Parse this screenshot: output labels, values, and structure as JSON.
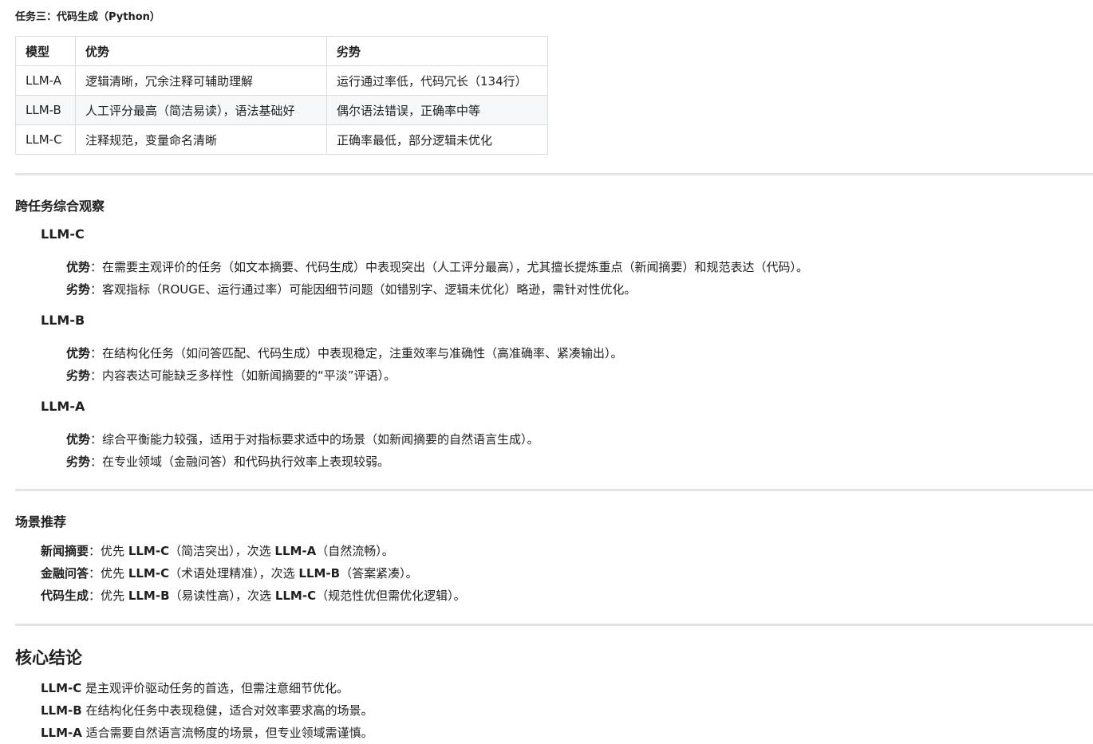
{
  "task3": {
    "title": "任务三：代码生成（Python）",
    "headers": [
      "模型",
      "优势",
      "劣势"
    ],
    "rows": [
      {
        "model": "LLM-A",
        "pro": "逻辑清晰，冗余注释可辅助理解",
        "con": "运行通过率低，代码冗长（134行）"
      },
      {
        "model": "LLM-B",
        "pro": "人工评分最高（简洁易读），语法基础好",
        "con": "偶尔语法错误，正确率中等"
      },
      {
        "model": "LLM-C",
        "pro": "注释规范，变量命名清晰",
        "con": "正确率最低，部分逻辑未优化"
      }
    ]
  },
  "cross": {
    "title": "跨任务综合观察",
    "pro_label": "优势",
    "con_label": "劣势",
    "sep": "：",
    "models": [
      {
        "name": "LLM-C",
        "pro": "在需要主观评价的任务（如文本摘要、代码生成）中表现突出（人工评分最高），尤其擅长提炼重点（新闻摘要）和规范表达（代码）。",
        "con": "客观指标（ROUGE、运行通过率）可能因细节问题（如错别字、逻辑未优化）略逊，需针对性优化。"
      },
      {
        "name": "LLM-B",
        "pro": "在结构化任务（如问答匹配、代码生成）中表现稳定，注重效率与准确性（高准确率、紧凑输出）。",
        "con": "内容表达可能缺乏多样性（如新闻摘要的“平淡”评语）。"
      },
      {
        "name": "LLM-A",
        "pro": "综合平衡能力较强，适用于对指标要求适中的场景（如新闻摘要的自然语言生成）。",
        "con": "在专业领域（金融问答）和代码执行效率上表现较弱。"
      }
    ]
  },
  "scenario": {
    "title": "场景推荐",
    "sep": "：",
    "first": "优先 ",
    "second": "，次选 ",
    "items": [
      {
        "label": "新闻摘要",
        "m1": "LLM-C",
        "r1": "（简洁突出）",
        "m2": "LLM-A",
        "r2": "（自然流畅）。"
      },
      {
        "label": "金融问答",
        "m1": "LLM-C",
        "r1": "（术语处理精准）",
        "m2": "LLM-B",
        "r2": "（答案紧凑）。"
      },
      {
        "label": "代码生成",
        "m1": "LLM-B",
        "r1": "（易读性高）",
        "m2": "LLM-C",
        "r2": "（规范性优但需优化逻辑）。"
      }
    ]
  },
  "conclusion": {
    "title": "核心结论",
    "items": [
      {
        "model": "LLM-C",
        "text": " 是主观评价驱动任务的首选，但需注意细节优化。"
      },
      {
        "model": "LLM-B",
        "text": " 在结构化任务中表现稳健，适合对效率要求高的场景。"
      },
      {
        "model": "LLM-A",
        "text": " 适合需要自然语言流畅度的场景，但专业领域需谨慎。"
      }
    ]
  }
}
